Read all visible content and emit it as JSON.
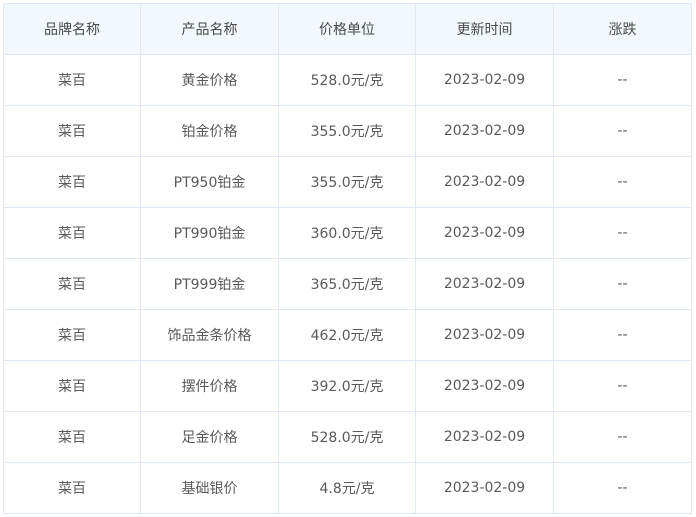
{
  "table": {
    "headers": [
      "品牌名称",
      "产品名称",
      "价格单位",
      "更新时间",
      "涨跌"
    ],
    "rows": [
      [
        "菜百",
        "黄金价格",
        "528.0元/克",
        "2023-02-09",
        "--"
      ],
      [
        "菜百",
        "铂金价格",
        "355.0元/克",
        "2023-02-09",
        "--"
      ],
      [
        "菜百",
        "PT950铂金",
        "355.0元/克",
        "2023-02-09",
        "--"
      ],
      [
        "菜百",
        "PT990铂金",
        "360.0元/克",
        "2023-02-09",
        "--"
      ],
      [
        "菜百",
        "PT999铂金",
        "365.0元/克",
        "2023-02-09",
        "--"
      ],
      [
        "菜百",
        "饰品金条价格",
        "462.0元/克",
        "2023-02-09",
        "--"
      ],
      [
        "菜百",
        "摆件价格",
        "392.0元/克",
        "2023-02-09",
        "--"
      ],
      [
        "菜百",
        "足金价格",
        "528.0元/克",
        "2023-02-09",
        "--"
      ],
      [
        "菜百",
        "基础银价",
        "4.8元/克",
        "2023-02-09",
        "--"
      ]
    ]
  }
}
